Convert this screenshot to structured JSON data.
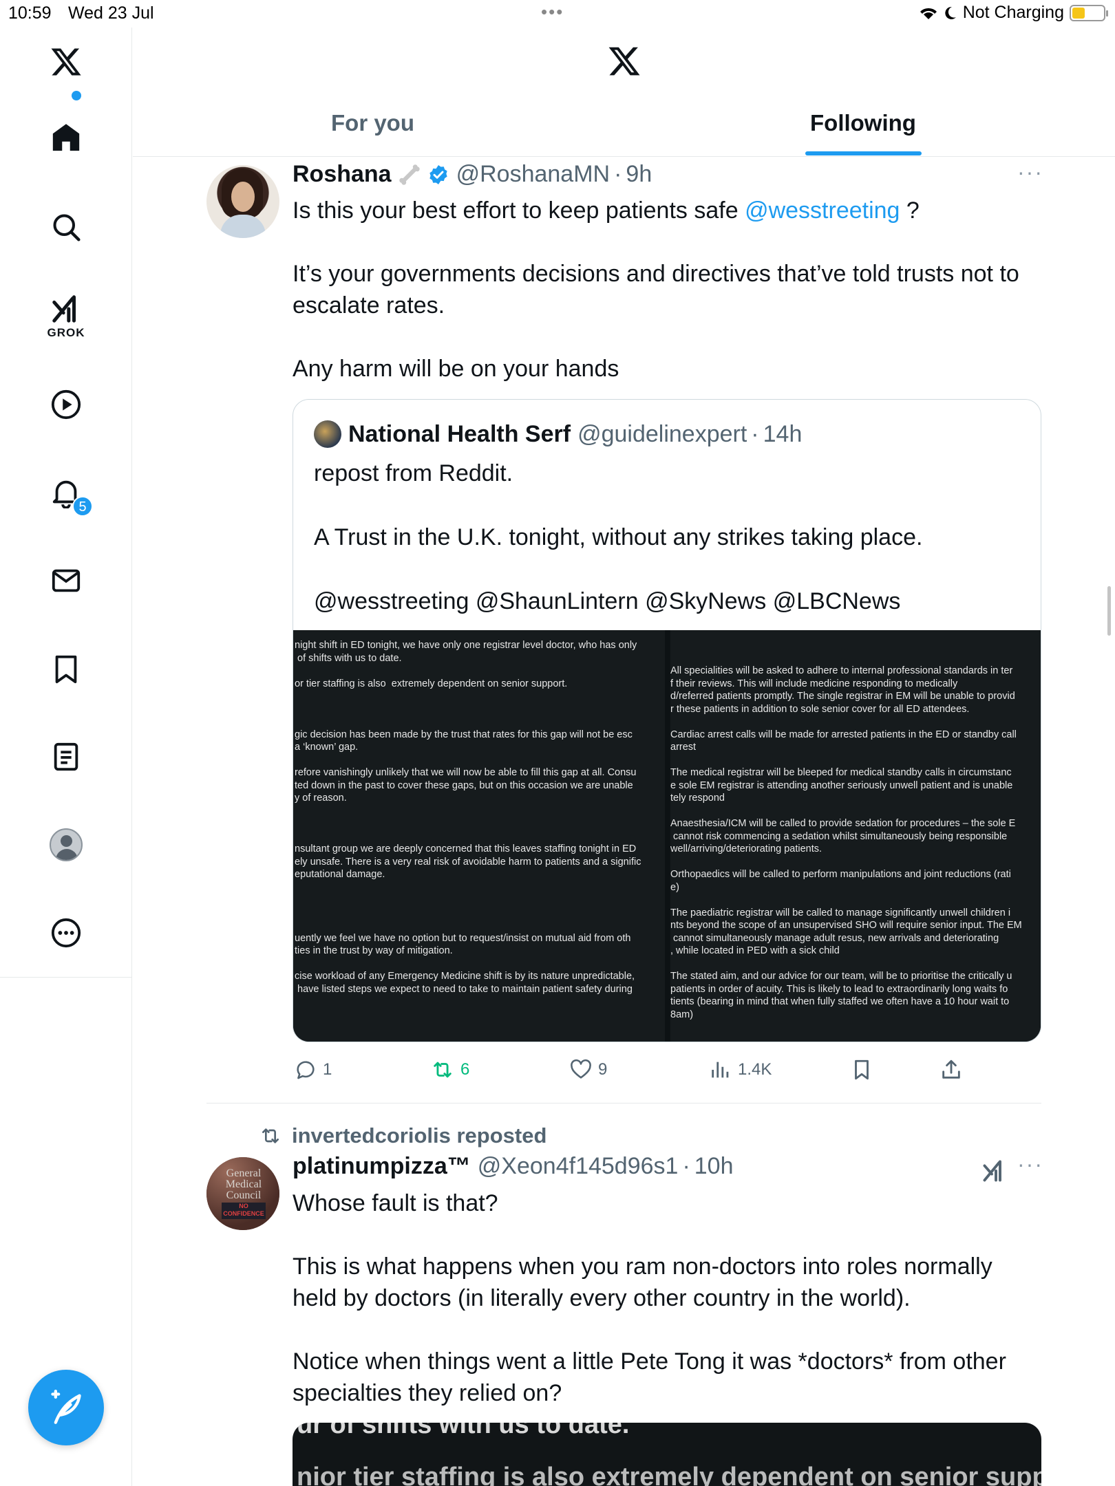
{
  "status_bar": {
    "time": "10:59",
    "date": "Wed 23 Jul",
    "dots": "•••",
    "charging": "Not Charging"
  },
  "sidebar": {
    "grok_label": "GROK",
    "notification_count": "5"
  },
  "header": {
    "tabs": [
      {
        "label": "For you",
        "active": false
      },
      {
        "label": "Following",
        "active": true
      }
    ]
  },
  "tweet1": {
    "name": "Roshana",
    "handle": "@RoshanaMN",
    "dot": "·",
    "time": "9h",
    "more": "···",
    "text_before_mention": "Is this your best effort to keep patients safe ",
    "mention": "@wesstreeting",
    "text_after_mention": " ?",
    "paragraph2": "It’s your governments decisions and directives that’ve told trusts not to escalate rates.",
    "paragraph3": "Any harm will be on your hands",
    "quote": {
      "name": "National Health Serf",
      "handle": "@guidelinexpert",
      "dot": "·",
      "time": "14h",
      "line1": "repost from Reddit.",
      "line2": "A Trust in the U.K. tonight, without any strikes taking place.",
      "line3": "@wesstreeting @ShaunLintern @SkyNews @LBCNews",
      "image_left": [
        "night shift in ED tonight, we have only one registrar level doctor, who has only",
        " of shifts with us to date.",
        "",
        "or tier staffing is also  extremely dependent on senior support.",
        "",
        "",
        "",
        "gic decision has been made by the trust that rates for this gap will not be esc",
        "a ‘known’ gap.",
        "",
        "refore vanishingly unlikely that we will now be able to fill this gap at all. Consu",
        "ted down in the past to cover these gaps, but on this occasion we are unable",
        "y of reason.",
        "",
        "",
        "",
        "nsultant group we are deeply concerned that this leaves staffing tonight in ED",
        "ely unsafe. There is a very real risk of avoidable harm to patients and a signific",
        "eputational damage.",
        "",
        "",
        "",
        "",
        "uently we feel we have no option but to request/insist on mutual aid from oth",
        "ties in the trust by way of mitigation.",
        "",
        "cise workload of any Emergency Medicine shift is by its nature unpredictable,",
        " have listed steps we expect to need to take to maintain patient safety during"
      ],
      "image_right": [
        "",
        "",
        "All specialities will be asked to adhere to internal professional standards in ter",
        "f their reviews. This will include medicine responding to medically",
        "d/referred patients promptly. The single registrar in EM will be unable to provid",
        "r these patients in addition to sole senior cover for all ED attendees.",
        "",
        "Cardiac arrest calls will be made for arrested patients in the ED or standby call",
        "arrest",
        "",
        "The medical registrar will be bleeped for medical standby calls in circumstanc",
        "e sole EM registrar is attending another seriously unwell patient and is unable",
        "tely respond",
        "",
        "Anaesthesia/ICM will be called to provide sedation for procedures – the sole E",
        " cannot risk commencing a sedation whilst simultaneously being responsible",
        "well/arriving/deteriorating patients.",
        "",
        "Orthopaedics will be called to perform manipulations and joint reductions (rati",
        "e)",
        "",
        "The paediatric registrar will be called to manage significantly unwell children i",
        "nts beyond the scope of an unsupervised SHO will require senior input. The EM",
        " cannot simultaneously manage adult resus, new arrivals and deteriorating",
        ", while located in PED with a sick child",
        "",
        "The stated aim, and our advice for our team, will be to prioritise the critically u",
        "patients in order of acuity. This is likely to lead to extraordinarily long waits fo",
        "tients (bearing in mind that when fully staffed we often have a 10 hour wait to",
        "8am)"
      ]
    },
    "actions": {
      "replies": "1",
      "reposts": "6",
      "likes": "9",
      "views": "1.4K"
    }
  },
  "tweet2": {
    "reposted_by": "invertedcoriolis reposted",
    "name": "platinumpizza™",
    "handle": "@Xeon4f145d96s1",
    "dot": "·",
    "time": "10h",
    "more": "···",
    "avatar_text": [
      "General",
      "Medical",
      "Council",
      "NO",
      "CONFIDENCE"
    ],
    "paragraph1": "Whose fault is that?",
    "paragraph2": "This is what happens when you ram non-doctors into roles normally held by doctors (in literally every other country in the world).",
    "paragraph3": "Notice when things went a little Pete Tong it was *doctors* from other specialties they relied on?",
    "media_peek_line1": "ur of shifts with us to date.",
    "media_peek_line2": "nior tier staffing is also extremely dependent on senior support."
  },
  "colors": {
    "accent": "#1d9bf0",
    "retweet_green": "#00ba7c",
    "secondary_text": "#536471",
    "verified": "#1d9bf0"
  },
  "icons": {
    "sidebar": [
      "x-logo-icon",
      "home-icon",
      "search-icon",
      "grok-icon",
      "video-icon",
      "bell-icon",
      "mail-icon",
      "bookmark-icon",
      "lists-icon",
      "profile-icon",
      "more-circle-icon"
    ],
    "actions": [
      "reply-icon",
      "repost-icon",
      "like-icon",
      "views-icon",
      "bookmark-icon",
      "share-icon"
    ]
  }
}
